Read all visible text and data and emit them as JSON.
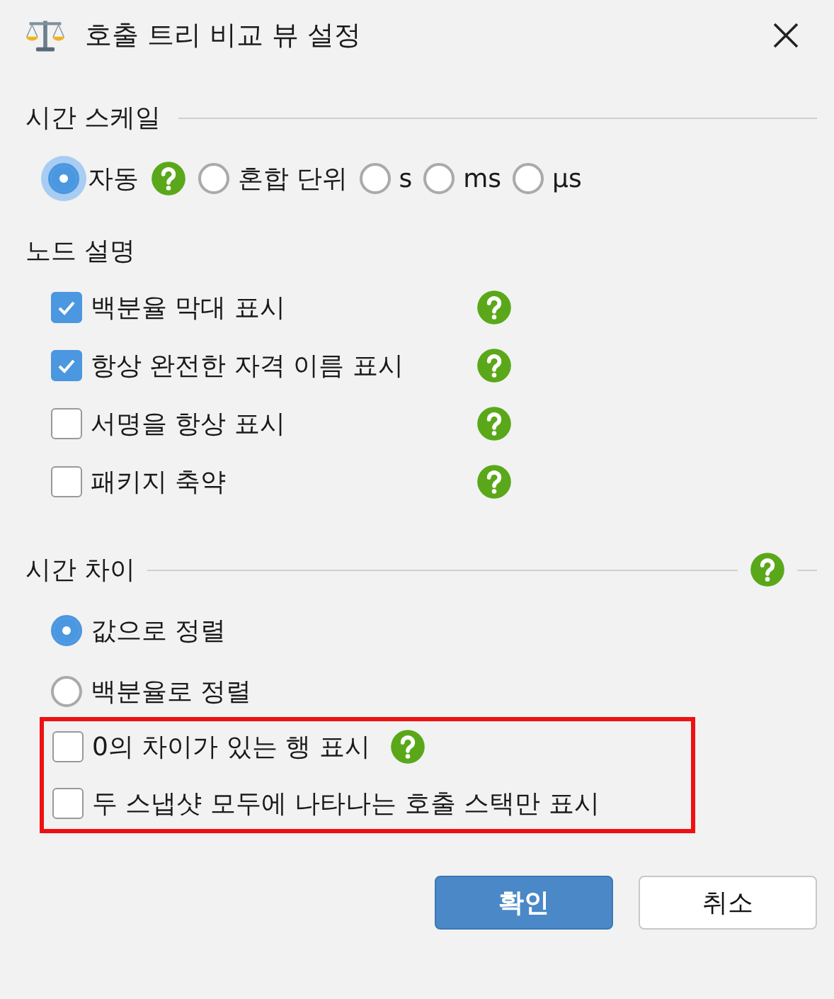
{
  "window": {
    "title": "호출 트리 비교 뷰 설정"
  },
  "time_scale": {
    "heading": "시간 스케일",
    "options": [
      {
        "label": "자동",
        "selected": true,
        "focused": true,
        "help": true
      },
      {
        "label": "혼합 단위",
        "selected": false,
        "focused": false,
        "help": false
      },
      {
        "label": "s",
        "selected": false,
        "focused": false,
        "help": false
      },
      {
        "label": "ms",
        "selected": false,
        "focused": false,
        "help": false
      },
      {
        "label": "µs",
        "selected": false,
        "focused": false,
        "help": false
      }
    ]
  },
  "node_description": {
    "heading": "노드 설명",
    "options": [
      {
        "label": "백분율 막대 표시",
        "checked": true,
        "help": true
      },
      {
        "label": "항상 완전한 자격 이름 표시",
        "checked": true,
        "help": true
      },
      {
        "label": "서명을 항상 표시",
        "checked": false,
        "help": true
      },
      {
        "label": "패키지 축약",
        "checked": false,
        "help": true
      }
    ]
  },
  "time_difference": {
    "heading": "시간 차이",
    "help": true,
    "sort_options": [
      {
        "label": "값으로 정렬",
        "selected": true
      },
      {
        "label": "백분율로 정렬",
        "selected": false
      }
    ],
    "highlighted_options": [
      {
        "label": "0의 차이가 있는 행 표시",
        "checked": false,
        "help": true
      },
      {
        "label": "두 스냅샷 모두에 나타나는 호출 스택만 표시",
        "checked": false,
        "help": false
      }
    ]
  },
  "buttons": [
    {
      "label": "확인",
      "kind": "primary"
    },
    {
      "label": "취소",
      "kind": "secondary"
    }
  ]
}
